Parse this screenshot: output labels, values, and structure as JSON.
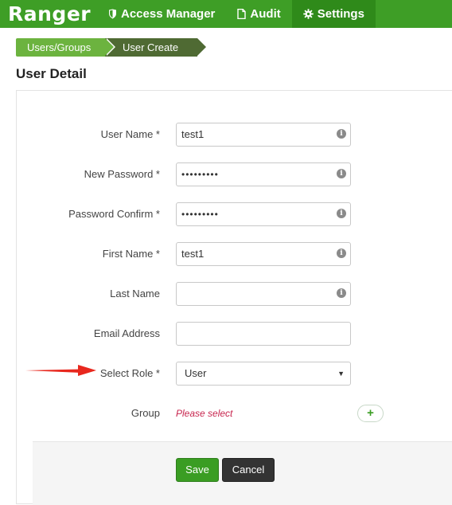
{
  "brand": "Ranger",
  "nav": {
    "access_manager": "Access Manager",
    "audit": "Audit",
    "settings": "Settings"
  },
  "breadcrumb": {
    "users_groups": "Users/Groups",
    "user_create": "User Create"
  },
  "page_title": "User Detail",
  "form": {
    "user_name": {
      "label": "User Name *",
      "value": "test1"
    },
    "new_password": {
      "label": "New Password *",
      "value": "•••••••••"
    },
    "password_confirm": {
      "label": "Password Confirm *",
      "value": "•••••••••"
    },
    "first_name": {
      "label": "First Name *",
      "value": "test1"
    },
    "last_name": {
      "label": "Last Name",
      "value": ""
    },
    "email_address": {
      "label": "Email Address",
      "value": ""
    },
    "select_role": {
      "label": "Select Role *",
      "value": "User"
    },
    "group": {
      "label": "Group",
      "placeholder": "Please select",
      "add_symbol": "+"
    }
  },
  "info_symbol": "i",
  "actions": {
    "save": "Save",
    "cancel": "Cancel"
  },
  "colors": {
    "header_green": "#3e9e26",
    "active_tab": "#2f8a1a",
    "breadcrumb_light": "#6cb33f",
    "breadcrumb_dark": "#4f6a33",
    "save_button": "#3a9d23",
    "cancel_button": "#333333",
    "placeholder_red": "#c7254e",
    "annotation_arrow": "#e8281e"
  }
}
